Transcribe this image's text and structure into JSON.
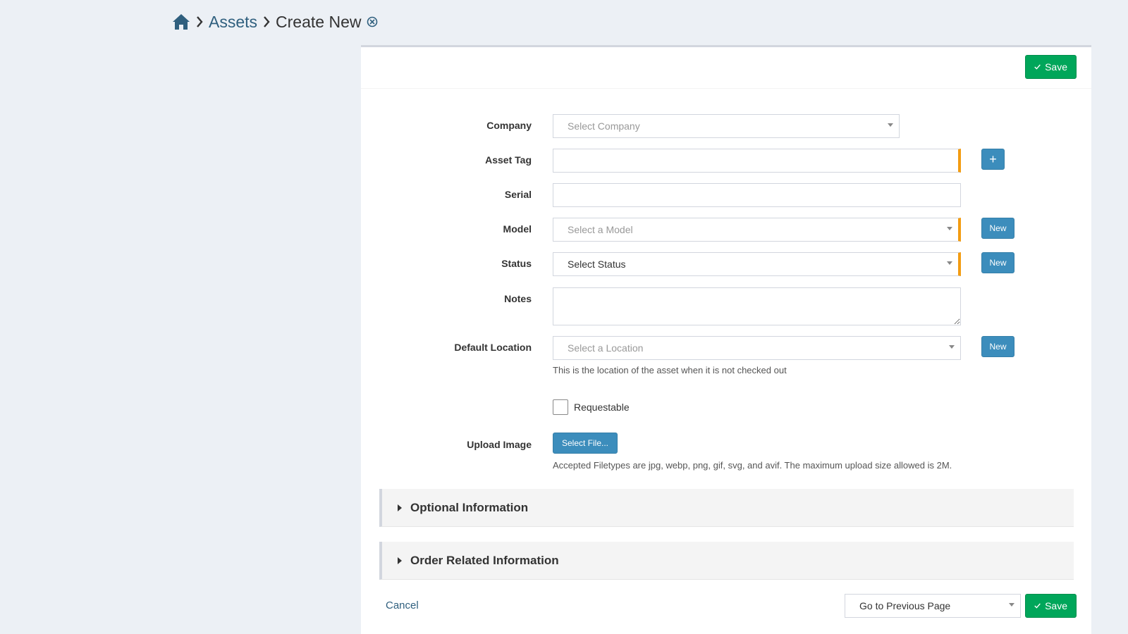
{
  "breadcrumb": {
    "home_icon": "home-icon",
    "assets_label": "Assets",
    "current_label": "Create New"
  },
  "toolbar": {
    "save_label": "Save"
  },
  "form": {
    "company": {
      "label": "Company",
      "placeholder": "Select Company"
    },
    "asset_tag": {
      "label": "Asset Tag",
      "value": "",
      "add_button": "+"
    },
    "serial": {
      "label": "Serial",
      "value": ""
    },
    "model": {
      "label": "Model",
      "placeholder": "Select a Model",
      "new_button": "New"
    },
    "status": {
      "label": "Status",
      "placeholder": "Select Status",
      "new_button": "New"
    },
    "notes": {
      "label": "Notes",
      "value": ""
    },
    "default_location": {
      "label": "Default Location",
      "placeholder": "Select a Location",
      "new_button": "New",
      "help": "This is the location of the asset when it is not checked out"
    },
    "requestable": {
      "label": "Requestable",
      "checked": false
    },
    "upload_image": {
      "label": "Upload Image",
      "button": "Select File...",
      "help": "Accepted Filetypes are jpg, webp, png, gif, svg, and avif. The maximum upload size allowed is 2M."
    }
  },
  "sections": {
    "optional": "Optional Information",
    "order": "Order Related Information"
  },
  "footer": {
    "cancel_label": "Cancel",
    "redirect_selected": "Go to Previous Page",
    "save_label": "Save"
  },
  "colors": {
    "accent_blue": "#3c8dbc",
    "save_green": "#00a65a",
    "required_orange": "#f39c12",
    "link_blue": "#2f5f7e"
  }
}
